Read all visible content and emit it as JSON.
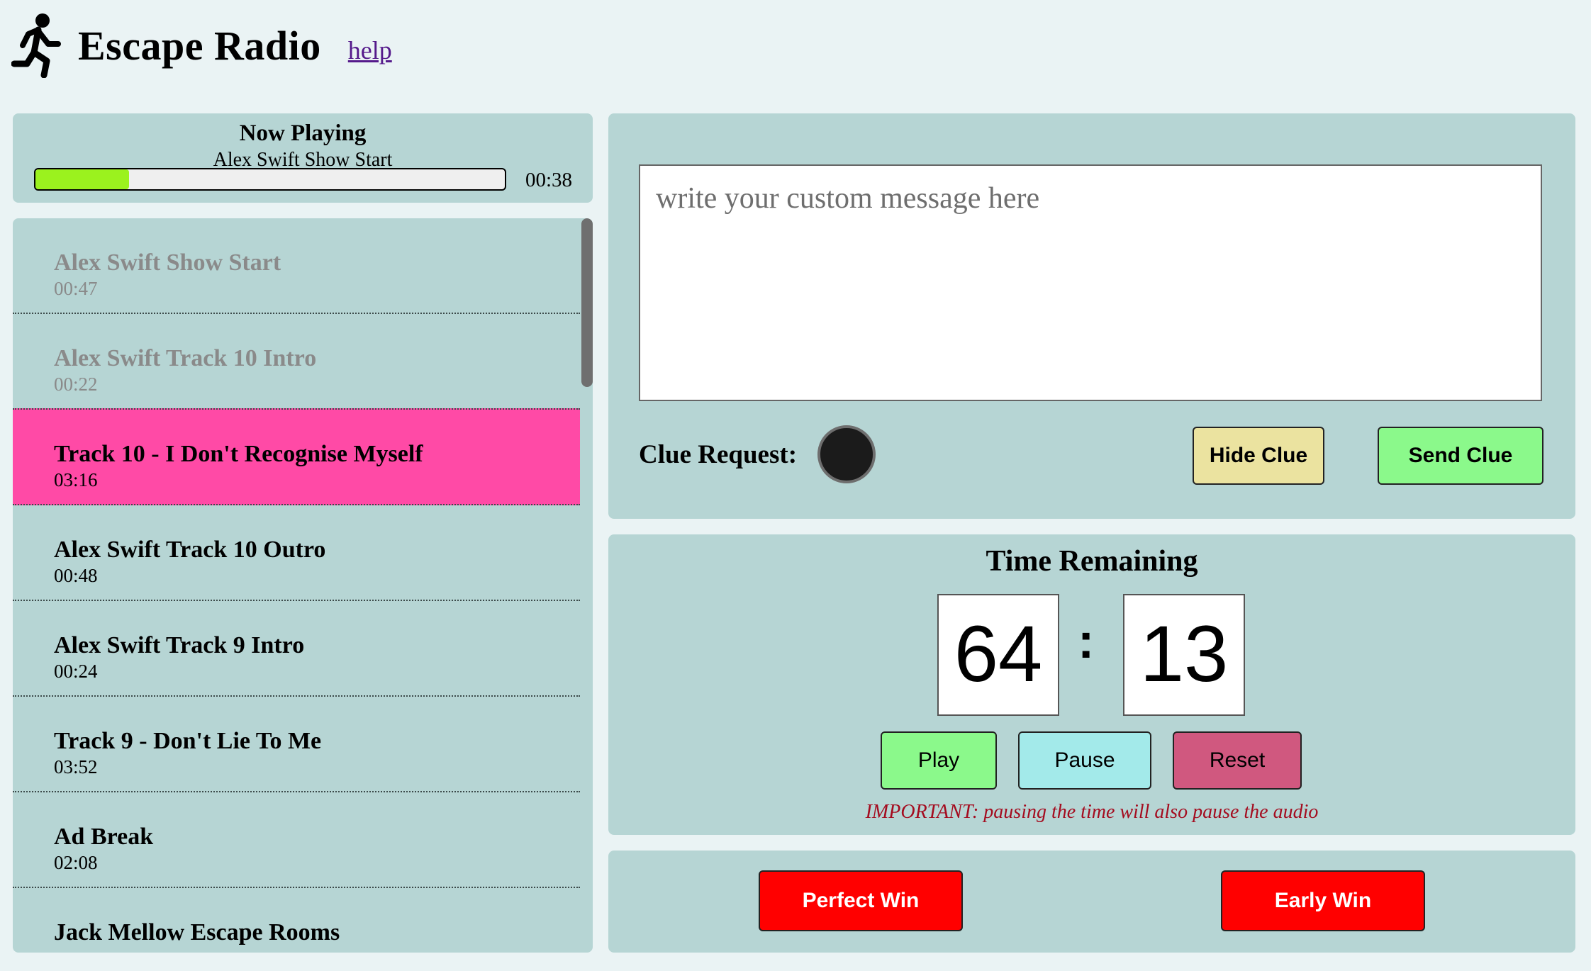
{
  "header": {
    "title": "Escape Radio",
    "help_link": "help",
    "logo_icon": "running-person-icon"
  },
  "now_playing": {
    "heading": "Now Playing",
    "track": "Alex Swift Show Start",
    "elapsed": "00:38",
    "progress_fraction": 0.2
  },
  "playlist": {
    "tracks": [
      {
        "name": "Alex Swift Show Start",
        "duration": "00:47",
        "state": "played"
      },
      {
        "name": "Alex Swift Track 10 Intro",
        "duration": "00:22",
        "state": "played"
      },
      {
        "name": "Track 10 - I Don't Recognise Myself",
        "duration": "03:16",
        "state": "active"
      },
      {
        "name": "Alex Swift Track 10 Outro",
        "duration": "00:48",
        "state": "upcoming"
      },
      {
        "name": "Alex Swift Track 9 Intro",
        "duration": "00:24",
        "state": "upcoming"
      },
      {
        "name": "Track 9 - Don't Lie To Me",
        "duration": "03:52",
        "state": "upcoming"
      },
      {
        "name": "Ad Break",
        "duration": "02:08",
        "state": "upcoming"
      },
      {
        "name": "Jack Mellow Escape Rooms",
        "duration": "",
        "state": "upcoming"
      }
    ]
  },
  "message": {
    "placeholder": "write your custom message here",
    "value": ""
  },
  "clue": {
    "label": "Clue Request:",
    "hide_label": "Hide Clue",
    "send_label": "Send Clue"
  },
  "timer": {
    "title": "Time Remaining",
    "minutes": "64",
    "separator": ":",
    "seconds": "13",
    "play_label": "Play",
    "pause_label": "Pause",
    "reset_label": "Reset",
    "notice": "IMPORTANT: pausing the time will also pause the audio"
  },
  "win": {
    "perfect_label": "Perfect Win",
    "early_label": "Early Win"
  },
  "colors": {
    "panel": "#b6d5d4",
    "page_bg": "#eaf3f4",
    "active_track": "#ff4aa6",
    "progress": "#9bf21e",
    "win_buttons": "#ff0000"
  }
}
